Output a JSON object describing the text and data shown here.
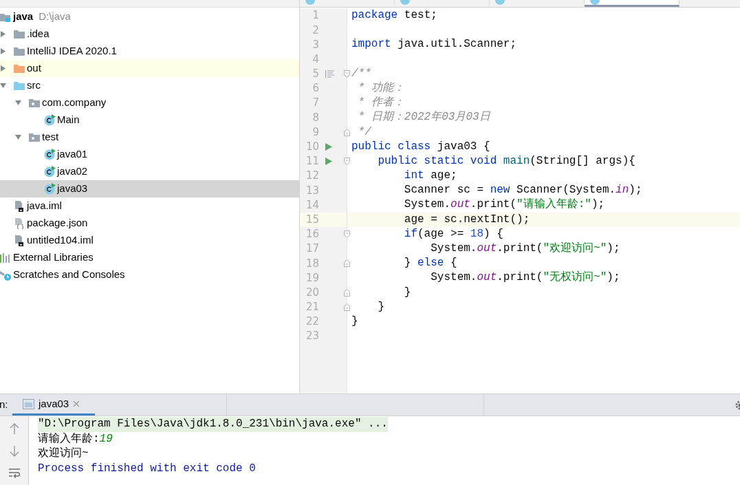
{
  "editor_tabs": [
    {
      "selected": false
    },
    {
      "selected": false
    },
    {
      "selected": false
    },
    {
      "selected": true
    }
  ],
  "project_tree": [
    {
      "label": "java",
      "kind": "module",
      "bold": true,
      "path": "D:\\java",
      "selected": false,
      "highlighted": false,
      "children": [
        {
          "label": ".idea",
          "kind": "folder",
          "expanded": false,
          "selected": false,
          "highlighted": false
        },
        {
          "label": "IntelliJ IDEA 2020.1",
          "kind": "folder",
          "expanded": false,
          "selected": false,
          "highlighted": false
        },
        {
          "label": "out",
          "kind": "excluded-folder",
          "expanded": false,
          "selected": false,
          "highlighted": true
        },
        {
          "label": "src",
          "kind": "source-folder",
          "expanded": true,
          "selected": false,
          "highlighted": false,
          "children": [
            {
              "label": "com.company",
              "kind": "package",
              "expanded": true,
              "selected": false,
              "highlighted": false,
              "children": [
                {
                  "label": "Main",
                  "kind": "class",
                  "selected": false,
                  "highlighted": false
                }
              ]
            },
            {
              "label": "test",
              "kind": "package",
              "expanded": true,
              "selected": false,
              "highlighted": false,
              "children": [
                {
                  "label": "java01",
                  "kind": "class",
                  "selected": false,
                  "highlighted": false
                },
                {
                  "label": "java02",
                  "kind": "class",
                  "selected": false,
                  "highlighted": false
                },
                {
                  "label": "java03",
                  "kind": "class",
                  "selected": true,
                  "highlighted": false
                }
              ]
            }
          ]
        },
        {
          "label": "java.iml",
          "kind": "iml",
          "selected": false,
          "highlighted": false
        },
        {
          "label": "package.json",
          "kind": "json",
          "selected": false,
          "highlighted": false
        },
        {
          "label": "untitled104.iml",
          "kind": "iml",
          "selected": false,
          "highlighted": false
        }
      ]
    },
    {
      "label": "External Libraries",
      "kind": "libraries",
      "bold": false,
      "selected": false,
      "highlighted": false
    },
    {
      "label": "Scratches and Consoles",
      "kind": "scratches",
      "bold": false,
      "selected": false,
      "highlighted": false
    }
  ],
  "code_lines": [
    {
      "number": "1",
      "run": false,
      "doc_marker": false,
      "fold_start": false,
      "fold_end": false,
      "current": false,
      "tokens": [
        {
          "text": "package",
          "kind": "keyword"
        },
        {
          "text": " test;",
          "kind": "plain"
        }
      ]
    },
    {
      "number": "2",
      "run": false,
      "doc_marker": false,
      "fold_start": false,
      "fold_end": false,
      "current": false
    },
    {
      "number": "3",
      "run": false,
      "doc_marker": false,
      "fold_start": false,
      "fold_end": false,
      "current": false,
      "tokens": [
        {
          "text": "import",
          "kind": "keyword"
        },
        {
          "text": " java.util.Scanner;",
          "kind": "plain"
        }
      ]
    },
    {
      "number": "4",
      "run": false,
      "doc_marker": false,
      "fold_start": false,
      "fold_end": false,
      "current": false
    },
    {
      "number": "5",
      "run": false,
      "doc_marker": true,
      "fold_start": true,
      "fold_end": false,
      "current": false,
      "tokens": [
        {
          "text": "/**",
          "kind": "comment"
        }
      ]
    },
    {
      "number": "6",
      "run": false,
      "doc_marker": false,
      "fold_start": false,
      "fold_end": false,
      "current": false,
      "tokens": [
        {
          "text": " * 功能：",
          "kind": "comment"
        }
      ]
    },
    {
      "number": "7",
      "run": false,
      "doc_marker": false,
      "fold_start": false,
      "fold_end": false,
      "current": false,
      "tokens": [
        {
          "text": " * 作者：",
          "kind": "comment"
        }
      ]
    },
    {
      "number": "8",
      "run": false,
      "doc_marker": false,
      "fold_start": false,
      "fold_end": false,
      "current": false,
      "tokens": [
        {
          "text": " * 日期：2022年03月03日",
          "kind": "comment"
        }
      ]
    },
    {
      "number": "9",
      "run": false,
      "doc_marker": false,
      "fold_start": false,
      "fold_end": true,
      "current": false,
      "tokens": [
        {
          "text": " */",
          "kind": "comment"
        }
      ]
    },
    {
      "number": "10",
      "run": true,
      "doc_marker": false,
      "fold_start": false,
      "fold_end": false,
      "current": false,
      "tokens": [
        {
          "text": "public class",
          "kind": "keyword"
        },
        {
          "text": " java03 {",
          "kind": "plain"
        }
      ]
    },
    {
      "number": "11",
      "run": true,
      "doc_marker": false,
      "fold_start": true,
      "fold_end": false,
      "current": false,
      "tokens": [
        {
          "text": "    public static void",
          "kind": "keyword"
        },
        {
          "text": " main",
          "kind": "method"
        },
        {
          "text": "(String[] args){",
          "kind": "plain"
        }
      ]
    },
    {
      "number": "12",
      "run": false,
      "doc_marker": false,
      "fold_start": false,
      "fold_end": false,
      "current": false,
      "tokens": [
        {
          "text": "        int",
          "kind": "keyword"
        },
        {
          "text": " age;",
          "kind": "plain"
        }
      ]
    },
    {
      "number": "13",
      "run": false,
      "doc_marker": false,
      "fold_start": false,
      "fold_end": false,
      "current": false,
      "tokens": [
        {
          "text": "        Scanner sc = ",
          "kind": "plain"
        },
        {
          "text": "new",
          "kind": "keyword"
        },
        {
          "text": " Scanner(System.",
          "kind": "plain"
        },
        {
          "text": "in",
          "kind": "field"
        },
        {
          "text": ");",
          "kind": "plain"
        }
      ]
    },
    {
      "number": "14",
      "run": false,
      "doc_marker": false,
      "fold_start": false,
      "fold_end": false,
      "current": false,
      "tokens": [
        {
          "text": "        System.",
          "kind": "plain"
        },
        {
          "text": "out",
          "kind": "field"
        },
        {
          "text": ".print(",
          "kind": "plain"
        },
        {
          "text": "\"请输入年龄:\"",
          "kind": "string"
        },
        {
          "text": ");",
          "kind": "plain"
        }
      ]
    },
    {
      "number": "15",
      "run": false,
      "doc_marker": false,
      "fold_start": false,
      "fold_end": false,
      "current": true,
      "tokens": [
        {
          "text": "        age = sc.nextInt();",
          "kind": "plain"
        }
      ]
    },
    {
      "number": "16",
      "run": false,
      "doc_marker": false,
      "fold_start": true,
      "fold_end": false,
      "current": false,
      "tokens": [
        {
          "text": "        if",
          "kind": "keyword"
        },
        {
          "text": "(age >= ",
          "kind": "plain"
        },
        {
          "text": "18",
          "kind": "number"
        },
        {
          "text": ") {",
          "kind": "plain"
        }
      ]
    },
    {
      "number": "17",
      "run": false,
      "doc_marker": false,
      "fold_start": false,
      "fold_end": false,
      "current": false,
      "tokens": [
        {
          "text": "            System.",
          "kind": "plain"
        },
        {
          "text": "out",
          "kind": "field"
        },
        {
          "text": ".print(",
          "kind": "plain"
        },
        {
          "text": "\"欢迎访问~\"",
          "kind": "string"
        },
        {
          "text": ");",
          "kind": "plain"
        }
      ]
    },
    {
      "number": "18",
      "run": false,
      "doc_marker": false,
      "fold_start": false,
      "fold_end": true,
      "current": false,
      "tokens": [
        {
          "text": "        } ",
          "kind": "plain"
        },
        {
          "text": "else",
          "kind": "keyword"
        },
        {
          "text": " {",
          "kind": "plain"
        }
      ]
    },
    {
      "number": "19",
      "run": false,
      "doc_marker": false,
      "fold_start": false,
      "fold_end": false,
      "current": false,
      "tokens": [
        {
          "text": "            System.",
          "kind": "plain"
        },
        {
          "text": "out",
          "kind": "field"
        },
        {
          "text": ".print(",
          "kind": "plain"
        },
        {
          "text": "\"无权访问~\"",
          "kind": "string"
        },
        {
          "text": ");",
          "kind": "plain"
        }
      ]
    },
    {
      "number": "20",
      "run": false,
      "doc_marker": false,
      "fold_start": false,
      "fold_end": true,
      "current": false,
      "tokens": [
        {
          "text": "        }",
          "kind": "plain"
        }
      ]
    },
    {
      "number": "21",
      "run": false,
      "doc_marker": false,
      "fold_start": false,
      "fold_end": true,
      "current": false,
      "tokens": [
        {
          "text": "    }",
          "kind": "plain"
        }
      ]
    },
    {
      "number": "22",
      "run": false,
      "doc_marker": false,
      "fold_start": false,
      "fold_end": false,
      "current": false,
      "tokens": [
        {
          "text": "}",
          "kind": "plain"
        }
      ]
    },
    {
      "number": "23",
      "run": false,
      "doc_marker": false,
      "fold_start": false,
      "fold_end": false,
      "current": false
    }
  ],
  "run_panel": {
    "label": "n:",
    "tabs": [
      {
        "label": "java03",
        "selected": true
      }
    ],
    "console_lines": [
      {
        "highlighted": true,
        "segments": [
          {
            "text": "\"D:\\Program Files\\Java\\jdk1.8.0_231\\bin\\java.exe\" ...",
            "kind": "output"
          }
        ]
      },
      {
        "highlighted": false,
        "segments": [
          {
            "text": "请输入年龄:",
            "kind": "output"
          },
          {
            "text": "19",
            "kind": "input"
          }
        ]
      },
      {
        "highlighted": false,
        "segments": [
          {
            "text": "欢迎访问~",
            "kind": "output"
          }
        ]
      },
      {
        "highlighted": false,
        "segments": [
          {
            "text": "Process finished with exit code 0",
            "kind": "system"
          }
        ]
      }
    ]
  }
}
